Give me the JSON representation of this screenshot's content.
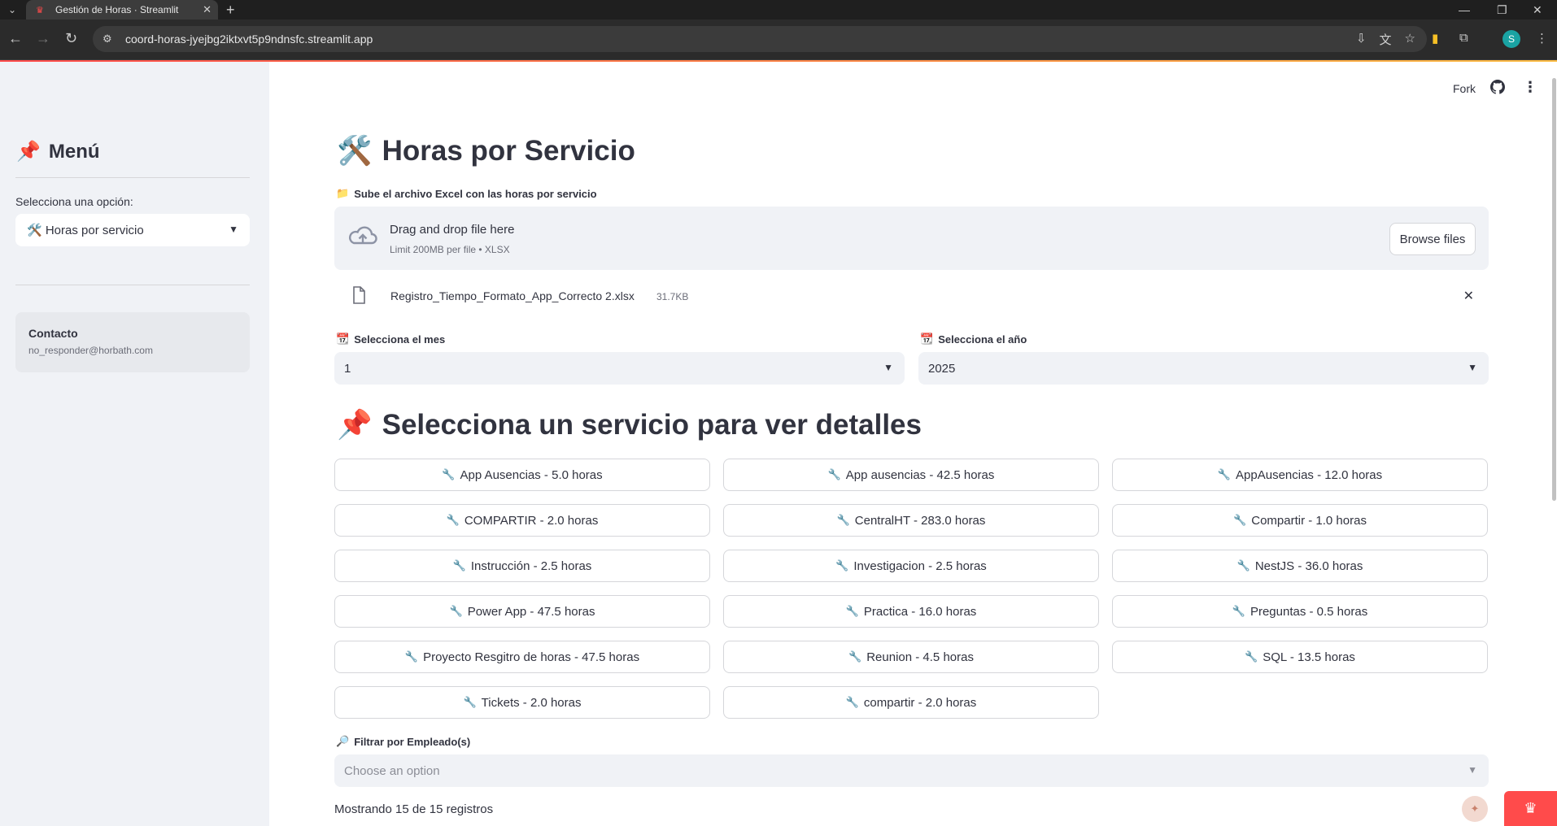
{
  "browser": {
    "tab_title": "Gestión de Horas · Streamlit",
    "url": "coord-horas-jyejbg2iktxvt5p9ndnsfc.streamlit.app",
    "profile_initial": "S"
  },
  "sidebar": {
    "title": "Menú",
    "title_icon": "📌",
    "select_label": "Selecciona una opción:",
    "select_value": "🛠️ Horas por servicio",
    "contact_title": "Contacto",
    "contact_email": "no_responder@horbath.com"
  },
  "toolbar": {
    "fork_label": "Fork"
  },
  "main": {
    "title": "Horas por Servicio",
    "title_icon": "🛠️",
    "uploader_label": "Sube el archivo Excel con las horas por servicio",
    "uploader_label_icon": "📁",
    "dropzone_text": "Drag and drop file here",
    "dropzone_limit": "Limit 200MB per file • XLSX",
    "browse_label": "Browse files",
    "file_name": "Registro_Tiempo_Formato_App_Correcto 2.xlsx",
    "file_size": "31.7KB",
    "month_label": "Selecciona el mes",
    "month_value": "1",
    "year_label": "Selecciona el año",
    "year_value": "2025",
    "calendar_icon": "📆",
    "section_title": "Selecciona un servicio para ver detalles",
    "section_icon": "📌",
    "services": [
      "App Ausencias - 5.0 horas",
      "App ausencias - 42.5 horas",
      "AppAusencias - 12.0 horas",
      "COMPARTIR - 2.0 horas",
      "CentralHT - 283.0 horas",
      "Compartir - 1.0 horas",
      "Instrucción - 2.5 horas",
      "Investigacion - 2.5 horas",
      "NestJS - 36.0 horas",
      "Power App - 47.5 horas",
      "Practica - 16.0 horas",
      "Preguntas - 0.5 horas",
      "Proyecto Resgitro de horas - 47.5 horas",
      "Reunion - 4.5 horas",
      "SQL - 13.5 horas",
      "Tickets - 2.0 horas",
      "compartir - 2.0 horas"
    ],
    "filter_label": "Filtrar por Empleado(s)",
    "filter_icon": "🔎",
    "filter_placeholder": "Choose an option",
    "showing_text": "Mostrando 15 de 15 registros"
  }
}
